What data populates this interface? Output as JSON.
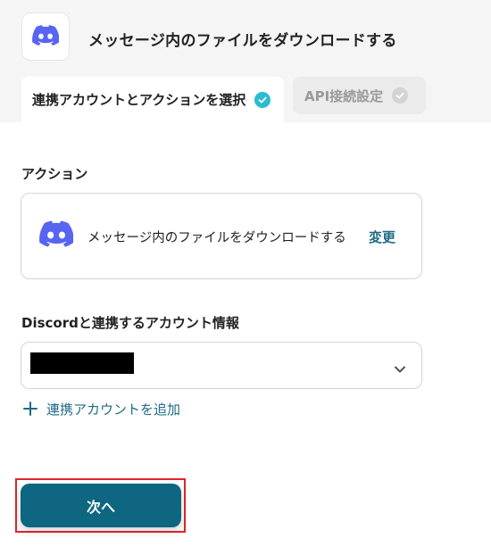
{
  "header": {
    "title": "メッセージ内のファイルをダウンロードする",
    "app_icon": "discord-icon",
    "tabs": [
      {
        "label": "連携アカウントとアクションを選択",
        "status": "complete",
        "status_color": "#29bcd3"
      },
      {
        "label": "API接続設定",
        "status": "incomplete",
        "status_color": "#d3d3d3"
      }
    ]
  },
  "action_section": {
    "label": "アクション",
    "card": {
      "icon": "discord-icon",
      "text": "メッセージ内のファイルをダウンロードする",
      "change_label": "変更"
    }
  },
  "account_section": {
    "label": "Discordと連携するアカウント情報",
    "selected_value_redacted": true,
    "dropdown_icon": "chevron-down-icon",
    "add_account_label": "連携アカウントを追加"
  },
  "footer": {
    "next_label": "次へ",
    "highlight_color": "#e0262b"
  },
  "colors": {
    "discord_brand": "#5865f2",
    "accent_link": "#1f6b85",
    "primary_button": "#0e6681",
    "check_complete": "#29bcd3"
  }
}
